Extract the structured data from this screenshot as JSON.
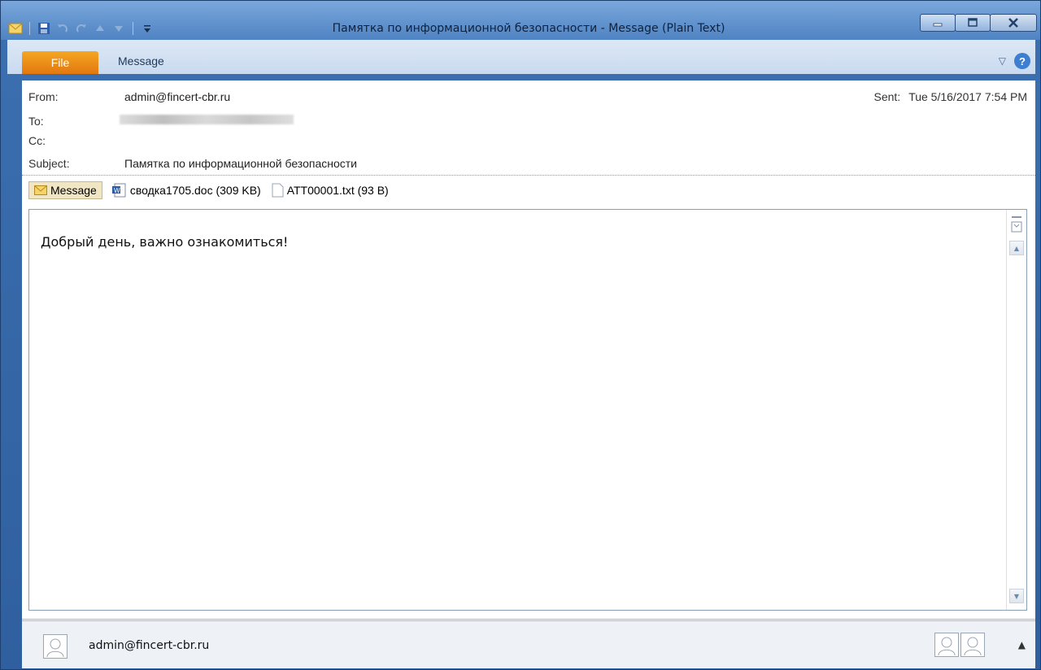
{
  "window": {
    "title": "Памятка по информационной безопасности  -  Message (Plain Text)"
  },
  "ribbon": {
    "file_tab": "File",
    "message_tab": "Message"
  },
  "header": {
    "from_label": "From:",
    "from_value": "admin@fincert-cbr.ru",
    "to_label": "To:",
    "cc_label": "Cc:",
    "subject_label": "Subject:",
    "subject_value": "Памятка по информационной безопасности",
    "sent_label": "Sent:",
    "sent_value": "Tue 5/16/2017 7:54 PM"
  },
  "attachments": {
    "message_label": "Message",
    "items": [
      {
        "label": "сводка1705.doc (309 KB)",
        "icon": "word-doc-icon"
      },
      {
        "label": "ATT00001.txt (93 B)",
        "icon": "text-file-icon"
      }
    ]
  },
  "body": {
    "text": "Добрый день, важно ознакомиться!"
  },
  "people_pane": {
    "name": "admin@fincert-cbr.ru"
  },
  "colors": {
    "titlebar": "#4f83c2",
    "file_tab": "#e2780f",
    "accent": "#3e7ed1"
  }
}
